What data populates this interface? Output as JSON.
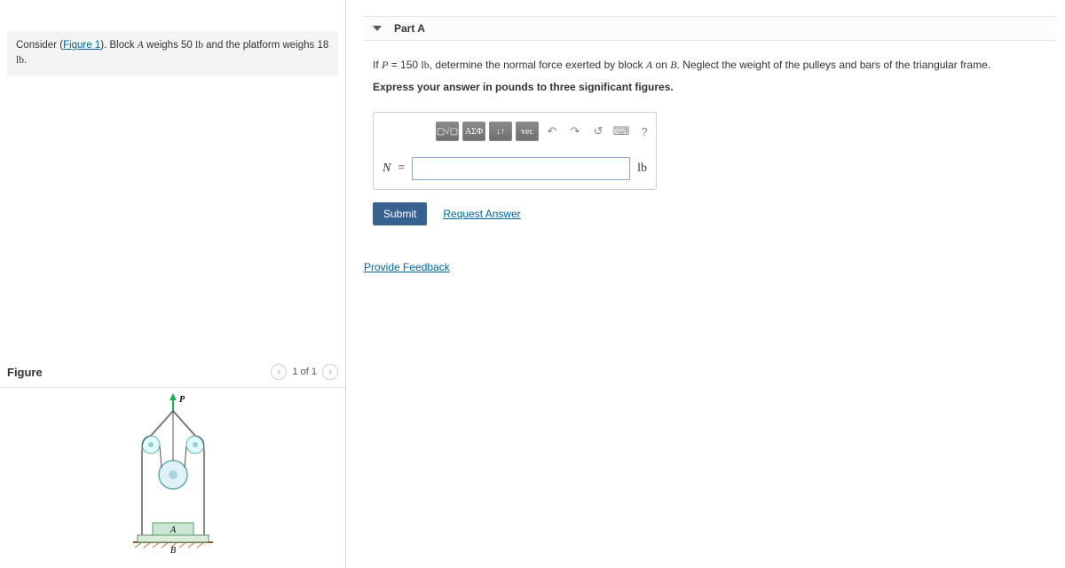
{
  "problem": {
    "prefix": "Consider (",
    "figure_link": "Figure 1",
    "suffix_before_A": "). Block ",
    "var_A": "A",
    "mid1": " weighs 50 ",
    "unit1": "lb",
    "mid2": " and the platform weighs 18 ",
    "unit2": "lb",
    "end": "."
  },
  "figure": {
    "title": "Figure",
    "pager": "1 of 1",
    "labels": {
      "P": "P",
      "A": "A",
      "B": "B"
    }
  },
  "part": {
    "header": "Part A",
    "line_if": "If ",
    "var_P": "P",
    "eq": " = 150 ",
    "unit_lb": "lb",
    "line_rest": ", determine the normal force exerted by block ",
    "var_A2": "A",
    "on": " on ",
    "var_B2": "B",
    "neglect": ". Neglect the weight of the pulleys and bars of the triangular frame.",
    "instr": "Express your answer in pounds to three significant figures."
  },
  "toolbar": {
    "templates": "▢√▢",
    "greek": "ΑΣΦ",
    "arrows": "↓↑",
    "vec": "vec",
    "undo": "↶",
    "redo": "↷",
    "reset": "↺",
    "keyboard": "⌨",
    "help": "?"
  },
  "answer": {
    "lhs": "N",
    "eq": " = ",
    "value": "",
    "unit": "lb"
  },
  "actions": {
    "submit": "Submit",
    "request": "Request Answer",
    "feedback": "Provide Feedback"
  }
}
